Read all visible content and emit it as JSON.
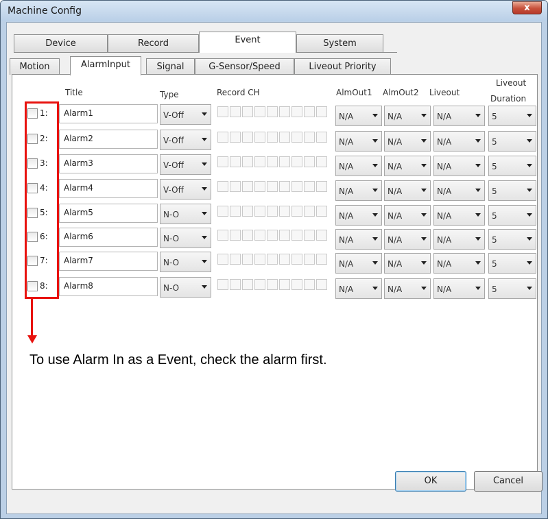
{
  "window": {
    "title": "Machine Config",
    "close_label": "x"
  },
  "main_tabs": [
    {
      "label": "Device"
    },
    {
      "label": "Record"
    },
    {
      "label": "Event"
    },
    {
      "label": "System"
    }
  ],
  "main_tabs_active": "Event",
  "sub_tabs": [
    {
      "label": "Motion"
    },
    {
      "label": "AlarmInput"
    },
    {
      "label": "Signal"
    },
    {
      "label": "G-Sensor/Speed"
    },
    {
      "label": "Liveout Priority"
    }
  ],
  "sub_tabs_active": "AlarmInput",
  "headers": {
    "title": "Title",
    "type": "Type",
    "record_ch": "Record CH",
    "almout1": "AlmOut1",
    "almout2": "AlmOut2",
    "liveout": "Liveout",
    "liveout_duration_1": "Liveout",
    "liveout_duration_2": "Duration"
  },
  "rows": [
    {
      "num": "1:",
      "title": "Alarm1",
      "type": "V-Off",
      "almout1": "N/A",
      "almout2": "N/A",
      "liveout": "N/A",
      "duration": "5",
      "checked": false
    },
    {
      "num": "2:",
      "title": "Alarm2",
      "type": "V-Off",
      "almout1": "N/A",
      "almout2": "N/A",
      "liveout": "N/A",
      "duration": "5",
      "checked": false
    },
    {
      "num": "3:",
      "title": "Alarm3",
      "type": "V-Off",
      "almout1": "N/A",
      "almout2": "N/A",
      "liveout": "N/A",
      "duration": "5",
      "checked": false
    },
    {
      "num": "4:",
      "title": "Alarm4",
      "type": "V-Off",
      "almout1": "N/A",
      "almout2": "N/A",
      "liveout": "N/A",
      "duration": "5",
      "checked": false
    },
    {
      "num": "5:",
      "title": "Alarm5",
      "type": "N-O",
      "almout1": "N/A",
      "almout2": "N/A",
      "liveout": "N/A",
      "duration": "5",
      "checked": false
    },
    {
      "num": "6:",
      "title": "Alarm6",
      "type": "N-O",
      "almout1": "N/A",
      "almout2": "N/A",
      "liveout": "N/A",
      "duration": "5",
      "checked": false
    },
    {
      "num": "7:",
      "title": "Alarm7",
      "type": "N-O",
      "almout1": "N/A",
      "almout2": "N/A",
      "liveout": "N/A",
      "duration": "5",
      "checked": false
    },
    {
      "num": "8:",
      "title": "Alarm8",
      "type": "N-O",
      "almout1": "N/A",
      "almout2": "N/A",
      "liveout": "N/A",
      "duration": "5",
      "checked": false
    }
  ],
  "annotation": {
    "note": "To use Alarm In as a Event, check the alarm first.",
    "highlight_color": "#e8120e"
  },
  "buttons": {
    "ok": "OK",
    "cancel": "Cancel"
  }
}
